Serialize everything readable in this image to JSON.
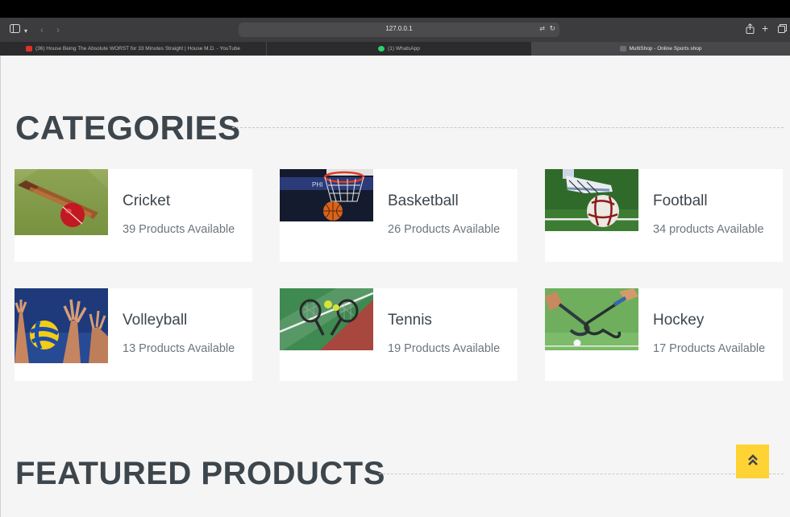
{
  "browser": {
    "address": "127.0.0.1",
    "icons": [
      "sidebar-icon",
      "chevron-down-icon",
      "back-icon",
      "forward-icon",
      "translate-icon",
      "reload-icon",
      "share-icon",
      "new-tab-icon",
      "tabs-overview-icon"
    ],
    "tabs": [
      {
        "label": "(36) House Being The Absolute WORST for 33 Minutes Straight | House M.D. - YouTube",
        "favicon": "youtube-icon",
        "active": false
      },
      {
        "label": "(1) WhatsApp",
        "favicon": "whatsapp-icon",
        "active": false
      },
      {
        "label": "MultiShop - Online Sports shop",
        "favicon": "multishop-icon",
        "active": true
      }
    ]
  },
  "page": {
    "categories_title": "CATEGORIES",
    "featured_title": "FEATURED PRODUCTS",
    "accent_color": "#ffd333",
    "categories": [
      {
        "name": "Cricket",
        "count": "39 Products Available",
        "image": "cricket-bat-and-ball"
      },
      {
        "name": "Basketball",
        "count": "26 Products Available",
        "image": "basketball-hoop"
      },
      {
        "name": "Football",
        "count": "34 products Available",
        "image": "football-kick"
      },
      {
        "name": "Volleyball",
        "count": "13 Products Available",
        "image": "volleyball-block"
      },
      {
        "name": "Tennis",
        "count": "19 Products Available",
        "image": "tennis-rackets"
      },
      {
        "name": "Hockey",
        "count": "17 Products Available",
        "image": "hockey-sticks"
      }
    ],
    "back_to_top_icon": "double-chevron-up-icon"
  }
}
